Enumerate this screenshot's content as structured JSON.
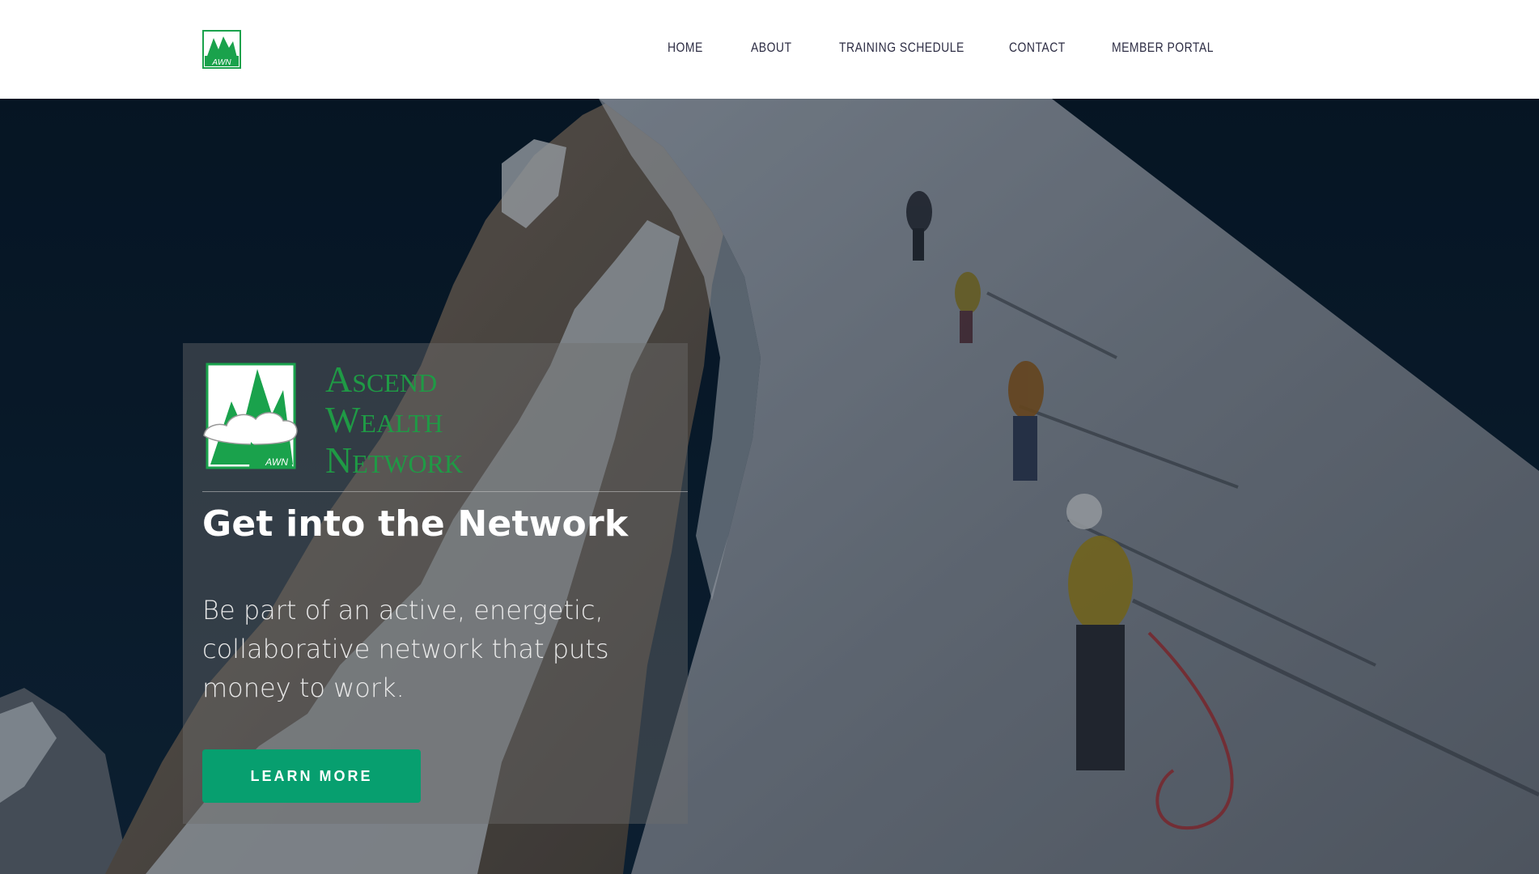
{
  "header": {
    "logo_text": "AWN",
    "nav": [
      {
        "label": "HOME"
      },
      {
        "label": "ABOUT"
      },
      {
        "label": "TRAINING SCHEDULE"
      },
      {
        "label": "CONTACT"
      },
      {
        "label": "MEMBER PORTAL"
      }
    ]
  },
  "hero": {
    "brand_lines": [
      "Ascend",
      "Wealth",
      "Network"
    ],
    "logo_text": "AWN",
    "title": "Get into the Network",
    "text": "Be part of an active, energetic, collaborative network that puts money to work.",
    "cta_label": "LEARN MORE"
  },
  "colors": {
    "brand_green": "#1f9a45",
    "cta_green": "#079f6f",
    "nav_text": "#2d2d44"
  },
  "icons": {
    "header_logo": "mountain-logo-icon",
    "card_logo": "mountain-cloud-logo-icon"
  }
}
